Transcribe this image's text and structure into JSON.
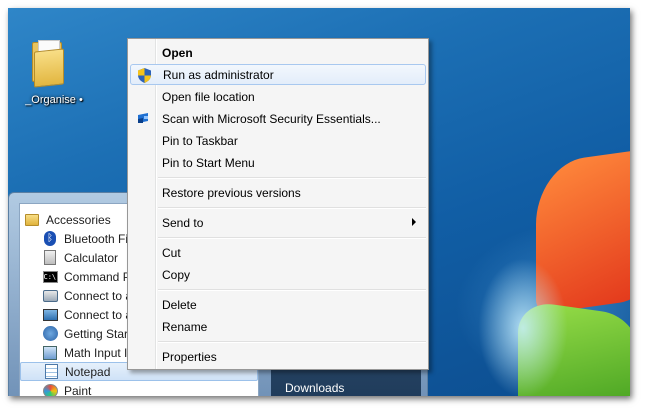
{
  "desktop": {
    "icon_label": "_Organise •"
  },
  "start_menu": {
    "programs": [
      {
        "label": "Accessories",
        "icon": "folder-icon",
        "kind": "folder"
      },
      {
        "label": "Bluetooth Fi",
        "icon": "bluetooth-icon",
        "kind": "app"
      },
      {
        "label": "Calculator",
        "icon": "calculator-icon",
        "kind": "app"
      },
      {
        "label": "Command P",
        "icon": "command-prompt-icon",
        "kind": "app"
      },
      {
        "label": "Connect to a",
        "icon": "network-projector-icon",
        "kind": "app"
      },
      {
        "label": "Connect to a",
        "icon": "projector-icon",
        "kind": "app"
      },
      {
        "label": "Getting Start",
        "icon": "getting-started-icon",
        "kind": "app"
      },
      {
        "label": "Math Input I",
        "icon": "math-input-icon",
        "kind": "app"
      },
      {
        "label": "Notepad",
        "icon": "notepad-icon",
        "kind": "app",
        "selected": true
      },
      {
        "label": "Paint",
        "icon": "paint-icon",
        "kind": "app"
      }
    ],
    "right_panel_item": "Downloads"
  },
  "context_menu": {
    "open": "Open",
    "run_as_admin": "Run as administrator",
    "open_file_location": "Open file location",
    "scan_mse": "Scan with Microsoft Security Essentials...",
    "pin_taskbar": "Pin to Taskbar",
    "pin_start": "Pin to Start Menu",
    "restore_versions": "Restore previous versions",
    "send_to": "Send to",
    "cut": "Cut",
    "copy": "Copy",
    "delete": "Delete",
    "rename": "Rename",
    "properties": "Properties"
  }
}
